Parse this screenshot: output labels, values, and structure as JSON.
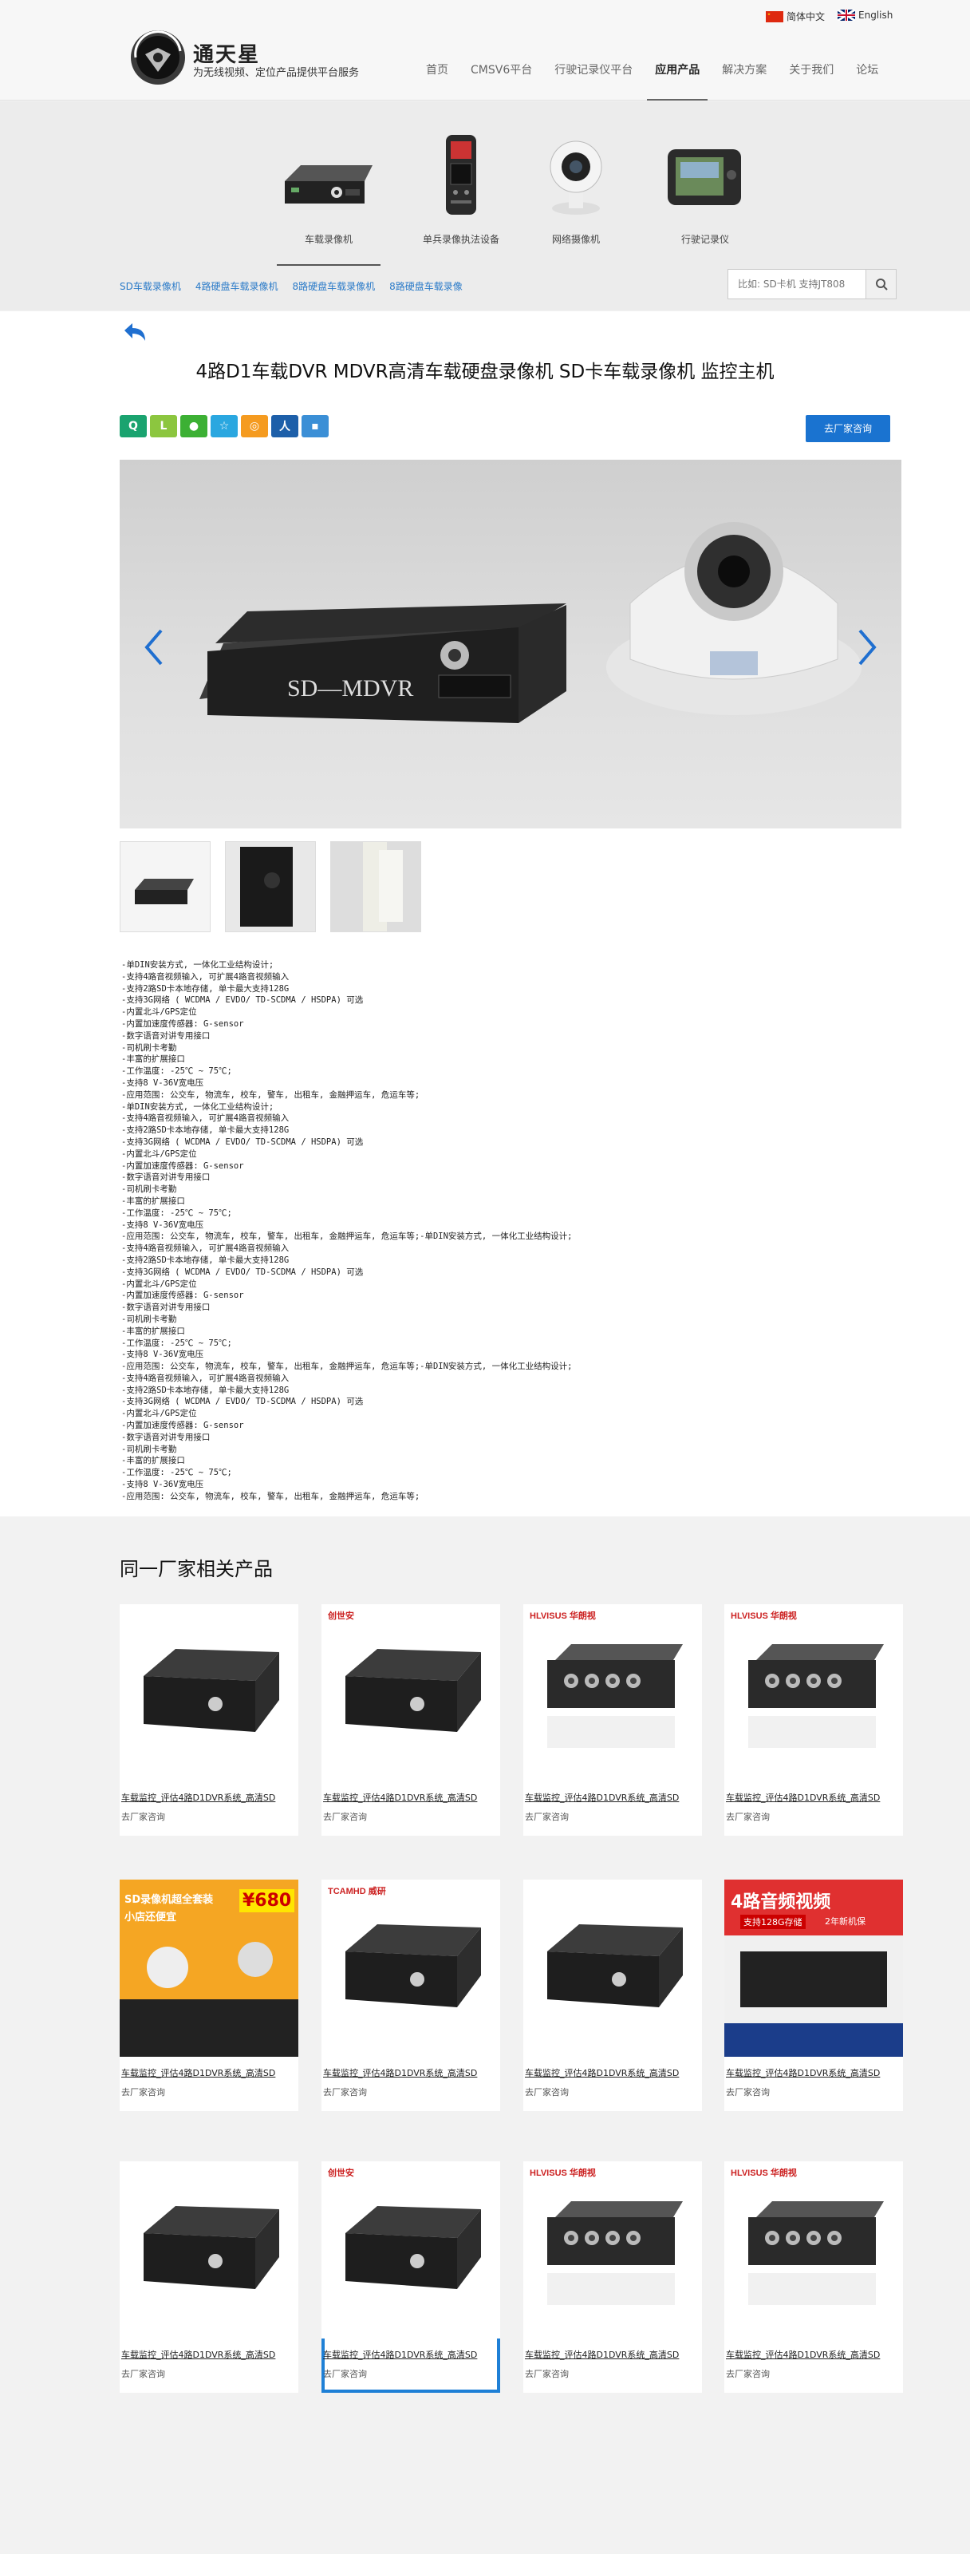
{
  "header": {
    "brand_name": "通天星",
    "slogan": "为无线视频、定位产品提供平台服务",
    "lang_cn": "简体中文",
    "lang_en": "English",
    "nav": [
      "首页",
      "CMSV6平台",
      "行驶记录仪平台",
      "应用产品",
      "解决方案",
      "关于我们",
      "论坛"
    ],
    "nav_active": "应用产品"
  },
  "categories": [
    "车载录像机",
    "单兵录像执法设备",
    "网络摄像机",
    "行驶记录仪"
  ],
  "sub_links": [
    "SD车载录像机",
    "4路硬盘车载录像机",
    "8路硬盘车载录像机",
    "8路硬盘车载录像"
  ],
  "search": {
    "placeholder": "比如: SD卡机 支持JT808"
  },
  "product": {
    "title": "4路D1车载DVR MDVR高清车载硬盘录像机 SD卡车载录像机 监控主机",
    "contact_label": "去厂家咨询",
    "hero_label": "SD—MDVR",
    "specs": [
      "-单DIN安装方式, 一体化工业结构设计;",
      "-支持4路音视频输入, 可扩展4路音视频输入",
      "-支持2路SD卡本地存储, 单卡最大支持128G",
      "-支持3G网络 ( WCDMA / EVDO/ TD-SCDMA / HSDPA) 可选",
      "-内置北斗/GPS定位",
      "-内置加速度传感器: G-sensor",
      "-数字语音对讲专用接口",
      "-司机刷卡考勤",
      "-丰富的扩展接口",
      "-工作温度: -25℃ ~ 75℃;",
      "-支持8 V-36V宽电压",
      "-应用范围: 公交车, 物流车, 校车, 警车, 出租车, 金融押运车, 危运车等;",
      "-单DIN安装方式, 一体化工业结构设计;",
      "-支持4路音视频输入, 可扩展4路音视频输入",
      "-支持2路SD卡本地存储, 单卡最大支持128G",
      "-支持3G网络 ( WCDMA / EVDO/ TD-SCDMA / HSDPA) 可选",
      "-内置北斗/GPS定位",
      "-内置加速度传感器: G-sensor",
      "-数字语音对讲专用接口",
      "-司机刷卡考勤",
      "-丰富的扩展接口",
      "-工作温度: -25℃ ~ 75℃;",
      "-支持8 V-36V宽电压",
      "-应用范围: 公交车, 物流车, 校车, 警车, 出租车, 金融押运车, 危运车等;-单DIN安装方式, 一体化工业结构设计;",
      "-支持4路音视频输入, 可扩展4路音视频输入",
      "-支持2路SD卡本地存储, 单卡最大支持128G",
      "-支持3G网络 ( WCDMA / EVDO/ TD-SCDMA / HSDPA) 可选",
      "-内置北斗/GPS定位",
      "-内置加速度传感器: G-sensor",
      "-数字语音对讲专用接口",
      "-司机刷卡考勤",
      "-丰富的扩展接口",
      "-工作温度: -25℃ ~ 75℃;",
      "-支持8 V-36V宽电压",
      "-应用范围: 公交车, 物流车, 校车, 警车, 出租车, 金融押运车, 危运车等;-单DIN安装方式, 一体化工业结构设计;",
      "-支持4路音视频输入, 可扩展4路音视频输入",
      "-支持2路SD卡本地存储, 单卡最大支持128G",
      "-支持3G网络 ( WCDMA / EVDO/ TD-SCDMA / HSDPA) 可选",
      "-内置北斗/GPS定位",
      "-内置加速度传感器: G-sensor",
      "-数字语音对讲专用接口",
      "-司机刷卡考勤",
      "-丰富的扩展接口",
      "-工作温度: -25℃ ~ 75℃;",
      "-支持8 V-36V宽电压",
      "-应用范围: 公交车, 物流车, 校车, 警车, 出租车, 金融押运车, 危运车等;"
    ]
  },
  "related": {
    "title": "同一厂家相关产品",
    "items": [
      {
        "name": "车载监控_评估4路D1DVR系统_高清SD",
        "action": "去厂家咨询",
        "brand": ""
      },
      {
        "name": "车载监控_评估4路D1DVR系统_高清SD",
        "action": "去厂家咨询",
        "brand": "创世安"
      },
      {
        "name": "车载监控_评估4路D1DVR系统_高清SD",
        "action": "去厂家咨询",
        "brand": "HLVISUS 华朗视"
      },
      {
        "name": "车载监控_评估4路D1DVR系统_高清SD",
        "action": "去厂家咨询",
        "brand": "HLVISUS 华朗视"
      },
      {
        "name": "车载监控_评估4路D1DVR系统_高清SD",
        "action": "去厂家咨询",
        "brand": ""
      },
      {
        "name": "车载监控_评估4路D1DVR系统_高清SD",
        "action": "去厂家咨询",
        "brand": "TCAMHD 威研"
      },
      {
        "name": "车载监控_评估4路D1DVR系统_高清SD",
        "action": "去厂家咨询",
        "brand": ""
      },
      {
        "name": "车载监控_评估4路D1DVR系统_高清SD",
        "action": "去厂家咨询",
        "brand": ""
      },
      {
        "name": "车载监控_评估4路D1DVR系统_高清SD",
        "action": "去厂家咨询",
        "brand": ""
      },
      {
        "name": "车载监控_评估4路D1DVR系统_高清SD",
        "action": "去厂家咨询",
        "brand": "创世安"
      },
      {
        "name": "车载监控_评估4路D1DVR系统_高清SD",
        "action": "去厂家咨询",
        "brand": "HLVISUS 华朗视"
      },
      {
        "name": "车载监控_评估4路D1DVR系统_高清SD",
        "action": "去厂家咨询",
        "brand": "HLVISUS 华朗视"
      }
    ],
    "promo1": {
      "line1": "SD录像机超全套装",
      "line2": "小店还便宜",
      "price": "¥680"
    },
    "promo2": {
      "line1": "4路音频视频",
      "line2": "支持128G存储",
      "badge": "2年新机保"
    }
  },
  "share_icons": [
    "qzone-icon",
    "line-icon",
    "wechat-icon",
    "star-icon",
    "weibo-icon",
    "renren-icon",
    "linkedin-icon"
  ],
  "colors": {
    "accent": "#1a73d0",
    "link": "#2a7ac8",
    "selected_border": "#1f80d6"
  }
}
